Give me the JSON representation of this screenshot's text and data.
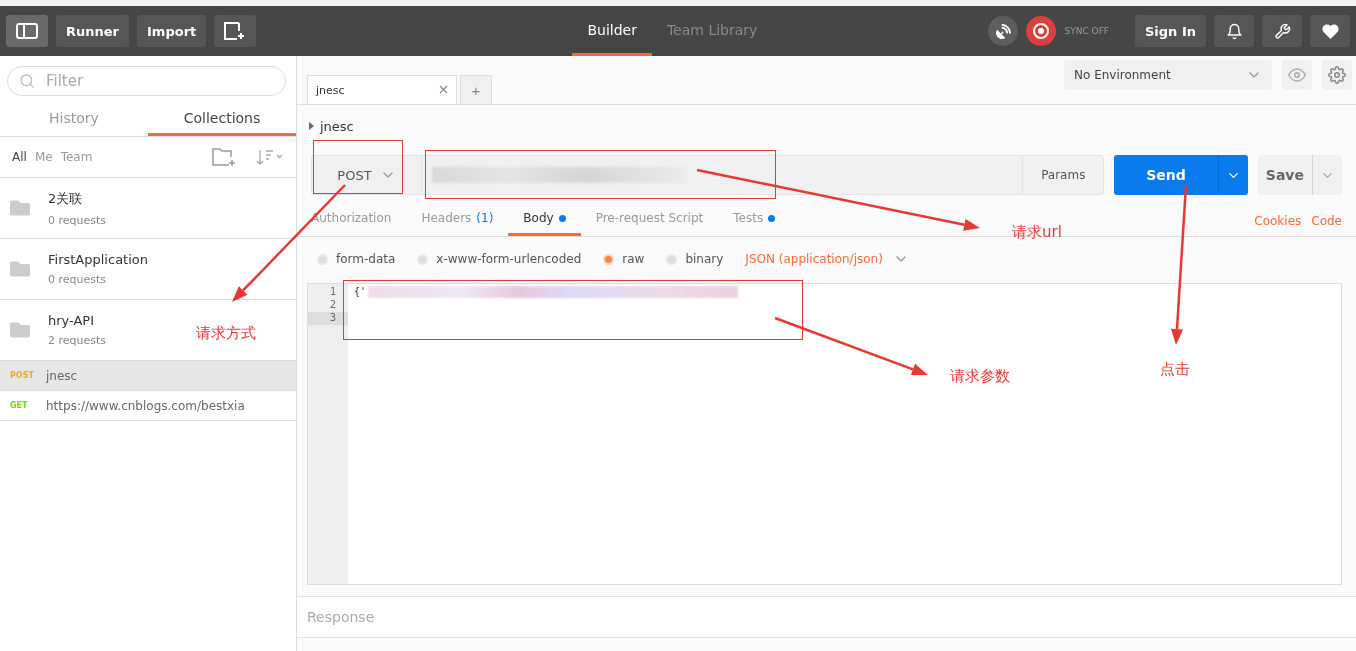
{
  "header": {
    "buttons": [
      {
        "kind": "sidebar"
      },
      {
        "kind": "text",
        "label": "Runner"
      },
      {
        "kind": "text",
        "label": "Import"
      },
      {
        "kind": "new"
      }
    ],
    "tabs": [
      {
        "label": "Builder",
        "selected": true
      },
      {
        "label": "Team Library",
        "selected": false
      }
    ],
    "sync": "SYNC OFF",
    "sign_in": "Sign In"
  },
  "sidebar": {
    "filter": {
      "placeholder": "Filter"
    },
    "tabs": [
      {
        "label": "History",
        "selected": false
      },
      {
        "label": "Collections",
        "selected": true
      }
    ],
    "scopes": [
      {
        "label": "All",
        "selected": true
      },
      {
        "label": "Me",
        "selected": false
      },
      {
        "label": "Team",
        "selected": false
      }
    ],
    "collections": [
      {
        "name": "2关联",
        "count": "0 requests"
      },
      {
        "name": "FirstApplication",
        "count": "0 requests"
      },
      {
        "name": "hry-API",
        "count": "2 requests"
      }
    ],
    "requests": [
      {
        "method": "POST",
        "color": "#f5a623",
        "name": "jnesc",
        "selected": true
      },
      {
        "method": "GET",
        "color": "#7ed321",
        "name": "https://www.cnblogs.com/bestxia",
        "selected": false
      }
    ]
  },
  "environment": "No Environment",
  "request_tab": {
    "label": "jnesc",
    "add": "+"
  },
  "breadcrumb": "jnesc",
  "request": {
    "method": "POST",
    "params": "Params",
    "send": "Send",
    "save": "Save"
  },
  "subtabs": [
    {
      "label": "Authorization",
      "selected": false,
      "dot": false
    },
    {
      "label": "Headers",
      "count": "(1)",
      "selected": false,
      "dot": false
    },
    {
      "label": "Body",
      "selected": true,
      "dot": true
    },
    {
      "label": "Pre-request Script",
      "selected": false,
      "dot": false
    },
    {
      "label": "Tests",
      "selected": false,
      "dot": true
    }
  ],
  "links": [
    "Cookies",
    "Code"
  ],
  "body_modes": [
    {
      "label": "form-data",
      "selected": false
    },
    {
      "label": "x-www-form-urlencoded",
      "selected": false
    },
    {
      "label": "raw",
      "selected": true
    },
    {
      "label": "binary",
      "selected": false
    }
  ],
  "content_type": "JSON (application/json)",
  "editor": {
    "line_numbers": [
      "1",
      "2",
      "3"
    ],
    "first_line": "{'"
  },
  "response": "Response",
  "annotations": {
    "labels": [
      {
        "text": "请求方式"
      },
      {
        "text": "请求url"
      },
      {
        "text": "请求参数"
      },
      {
        "text": "点击"
      }
    ]
  }
}
